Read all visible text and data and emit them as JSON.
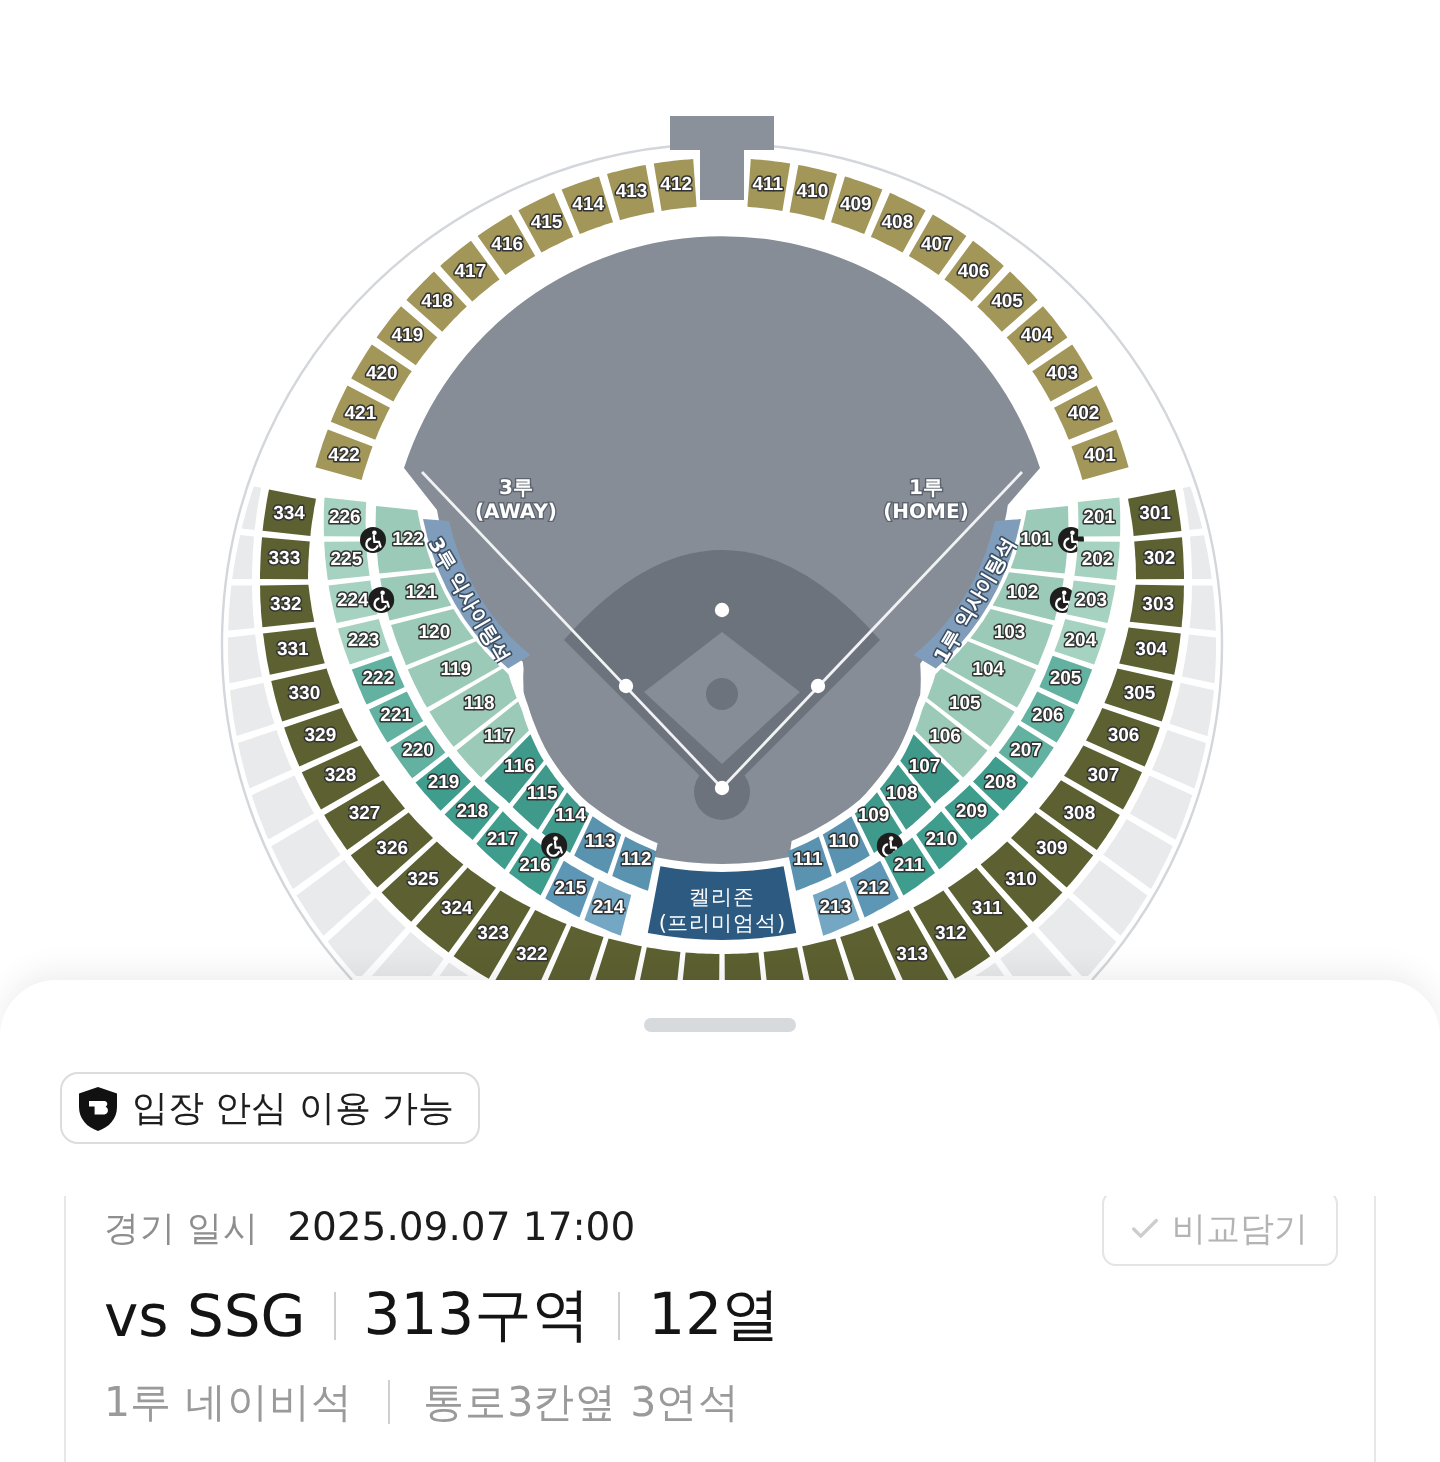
{
  "stadium_map": {
    "base_labels": [
      {
        "kind": "third_base",
        "lines": [
          "3루",
          "(AWAY)"
        ]
      },
      {
        "kind": "first_base",
        "lines": [
          "1루",
          "(HOME)"
        ]
      }
    ],
    "outfield_sections": [
      {
        "label": "422",
        "color": "#a29659"
      },
      {
        "label": "421",
        "color": "#a29659"
      },
      {
        "label": "420",
        "color": "#a29659"
      },
      {
        "label": "419",
        "color": "#a29659"
      },
      {
        "label": "418",
        "color": "#a29659"
      },
      {
        "label": "417",
        "color": "#a29659"
      },
      {
        "label": "416",
        "color": "#a29659"
      },
      {
        "label": "415",
        "color": "#a29659"
      },
      {
        "label": "414",
        "color": "#a29659"
      },
      {
        "label": "413",
        "color": "#a29659"
      },
      {
        "label": "412",
        "color": "#a29659"
      },
      {
        "label": "411",
        "color": "#a29659"
      },
      {
        "label": "410",
        "color": "#a29659"
      },
      {
        "label": "409",
        "color": "#a29659"
      },
      {
        "label": "408",
        "color": "#a29659"
      },
      {
        "label": "407",
        "color": "#a29659"
      },
      {
        "label": "406",
        "color": "#a29659"
      },
      {
        "label": "405",
        "color": "#a29659"
      },
      {
        "label": "404",
        "color": "#a29659"
      },
      {
        "label": "403",
        "color": "#a29659"
      },
      {
        "label": "402",
        "color": "#a29659"
      },
      {
        "label": "401",
        "color": "#a29659"
      }
    ],
    "exciting_zones": [
      {
        "kind": "third_base",
        "label": "3루 익사이팅석"
      },
      {
        "kind": "first_base",
        "label": "1루 익사이팅석"
      }
    ],
    "level_300_left": [
      {
        "label": "334",
        "color": "#5d6131"
      },
      {
        "label": "333",
        "color": "#5d6131"
      },
      {
        "label": "332",
        "color": "#5d6131"
      },
      {
        "label": "331",
        "color": "#5d6131"
      },
      {
        "label": "330",
        "color": "#5d6131"
      },
      {
        "label": "329",
        "color": "#5d6131"
      },
      {
        "label": "328",
        "color": "#5d6131"
      },
      {
        "label": "327",
        "color": "#5d6131"
      },
      {
        "label": "326",
        "color": "#5d6131"
      },
      {
        "label": "325",
        "color": "#5d6131"
      },
      {
        "label": "324",
        "color": "#5d6131"
      },
      {
        "label": "323",
        "color": "#5d6131"
      },
      {
        "label": "322",
        "color": "#5d6131"
      }
    ],
    "level_200_left": [
      {
        "label": "226",
        "color": "#a6d2c2"
      },
      {
        "label": "225",
        "color": "#a6d2c2"
      },
      {
        "label": "224",
        "color": "#a6d2c2"
      },
      {
        "label": "223",
        "color": "#a6d2c2"
      },
      {
        "label": "222",
        "color": "#63b2a1"
      },
      {
        "label": "221",
        "color": "#63b2a1"
      },
      {
        "label": "220",
        "color": "#63b2a1"
      },
      {
        "label": "219",
        "color": "#3f9d8d"
      },
      {
        "label": "218",
        "color": "#3f9d8d"
      },
      {
        "label": "217",
        "color": "#3f9d8d"
      },
      {
        "label": "216",
        "color": "#3f9d8d"
      },
      {
        "label": "215",
        "color": "#5e97b6"
      },
      {
        "label": "214",
        "color": "#74a7c3"
      }
    ],
    "level_100_left": [
      {
        "label": "122",
        "color": "#9ccab8",
        "accessible": true
      },
      {
        "label": "121",
        "color": "#9ccab8",
        "accessible": true
      },
      {
        "label": "120",
        "color": "#9ccab8",
        "accessible": false
      },
      {
        "label": "119",
        "color": "#9ccab8",
        "accessible": false
      },
      {
        "label": "118",
        "color": "#9ccab8",
        "accessible": false
      },
      {
        "label": "117",
        "color": "#9ccab8",
        "accessible": false
      },
      {
        "label": "116",
        "color": "#3f9a8c",
        "accessible": false
      },
      {
        "label": "115",
        "color": "#3f9a8c",
        "accessible": false
      },
      {
        "label": "114",
        "color": "#3f9a8c",
        "accessible": true
      },
      {
        "label": "113",
        "color": "#5a93af",
        "accessible": false
      },
      {
        "label": "112",
        "color": "#5a93af",
        "accessible": false
      }
    ],
    "premium_zone": {
      "lines": [
        "켈리존",
        "(프리미엄석)"
      ]
    },
    "level_100_right": [
      {
        "label": "101",
        "color": "#9ccab8",
        "accessible": true
      },
      {
        "label": "102",
        "color": "#9ccab8",
        "accessible": true
      },
      {
        "label": "103",
        "color": "#9ccab8",
        "accessible": false
      },
      {
        "label": "104",
        "color": "#9ccab8",
        "accessible": false
      },
      {
        "label": "105",
        "color": "#9ccab8",
        "accessible": false
      },
      {
        "label": "106",
        "color": "#9ccab8",
        "accessible": false
      },
      {
        "label": "107",
        "color": "#3f9a8c",
        "accessible": false
      },
      {
        "label": "108",
        "color": "#3f9a8c",
        "accessible": false
      },
      {
        "label": "109",
        "color": "#3f9a8c",
        "accessible": true
      },
      {
        "label": "110",
        "color": "#5a93af",
        "accessible": false
      },
      {
        "label": "111",
        "color": "#5a93af",
        "accessible": false
      }
    ],
    "level_200_right": [
      {
        "label": "201",
        "color": "#a6d2c2"
      },
      {
        "label": "202",
        "color": "#a6d2c2"
      },
      {
        "label": "203",
        "color": "#a6d2c2"
      },
      {
        "label": "204",
        "color": "#a6d2c2"
      },
      {
        "label": "205",
        "color": "#63b2a1"
      },
      {
        "label": "206",
        "color": "#63b2a1"
      },
      {
        "label": "207",
        "color": "#63b2a1"
      },
      {
        "label": "208",
        "color": "#3f9d8d"
      },
      {
        "label": "209",
        "color": "#3f9d8d"
      },
      {
        "label": "210",
        "color": "#3f9d8d"
      },
      {
        "label": "211",
        "color": "#3f9d8d"
      },
      {
        "label": "212",
        "color": "#5e97b6"
      },
      {
        "label": "213",
        "color": "#74a7c3"
      }
    ],
    "level_300_right": [
      {
        "label": "301",
        "color": "#5d6131"
      },
      {
        "label": "302",
        "color": "#5d6131"
      },
      {
        "label": "303",
        "color": "#5d6131"
      },
      {
        "label": "304",
        "color": "#5d6131"
      },
      {
        "label": "305",
        "color": "#5d6131"
      },
      {
        "label": "306",
        "color": "#5d6131"
      },
      {
        "label": "307",
        "color": "#5d6131"
      },
      {
        "label": "308",
        "color": "#5d6131"
      },
      {
        "label": "309",
        "color": "#5d6131"
      },
      {
        "label": "310",
        "color": "#5d6131"
      },
      {
        "label": "311",
        "color": "#5d6131"
      },
      {
        "label": "312",
        "color": "#5d6131"
      },
      {
        "label": "313",
        "color": "#5d6131"
      }
    ],
    "level_300_bottom": [
      {
        "color": "#5d6131"
      },
      {
        "color": "#5d6131"
      },
      {
        "color": "#5d6131"
      },
      {
        "color": "#5d6131"
      },
      {
        "color": "#5d6131"
      },
      {
        "color": "#5d6131"
      },
      {
        "color": "#5d6131"
      },
      {
        "color": "#5d6131"
      }
    ]
  },
  "bottom_sheet": {
    "badge": {
      "label": "입장 안심 이용 가능"
    },
    "listing": {
      "date_label": "경기 일시",
      "date_value": "2025.09.07 17:00",
      "compare_button": {
        "label": "비교담기",
        "checked": false
      },
      "title_parts": [
        "vs SSG",
        "313구역",
        "12열"
      ],
      "details": [
        "1루 네이비석",
        "통로3칸옆 3연석"
      ]
    }
  }
}
